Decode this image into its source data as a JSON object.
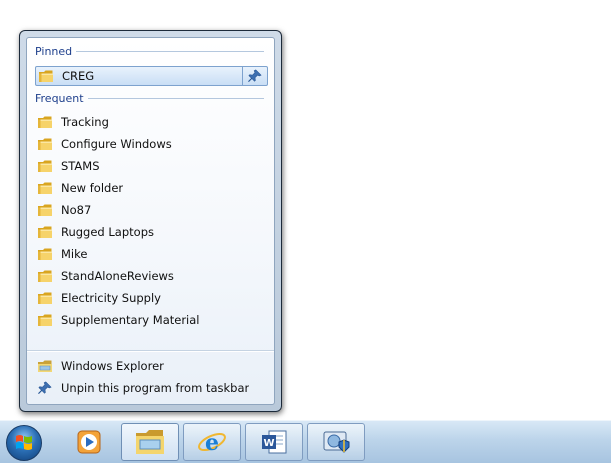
{
  "jumplist": {
    "pinned_header": "Pinned",
    "pinned_items": [
      {
        "label": "CREG"
      }
    ],
    "frequent_header": "Frequent",
    "frequent_items": [
      {
        "label": "Tracking"
      },
      {
        "label": "Configure Windows"
      },
      {
        "label": "STAMS"
      },
      {
        "label": "New folder"
      },
      {
        "label": "No87"
      },
      {
        "label": "Rugged Laptops"
      },
      {
        "label": "Mike"
      },
      {
        "label": "StandAloneReviews"
      },
      {
        "label": "Electricity Supply"
      },
      {
        "label": "Supplementary Material"
      }
    ],
    "tasks": [
      {
        "label": "Windows Explorer",
        "icon": "explorer-icon"
      },
      {
        "label": "Unpin this program from taskbar",
        "icon": "pin-icon"
      }
    ]
  },
  "taskbar": {
    "buttons": [
      {
        "name": "start-orb",
        "icon": "windows-logo-icon"
      },
      {
        "name": "media-player",
        "icon": "media-player-icon"
      },
      {
        "name": "windows-explorer",
        "icon": "explorer-icon",
        "state": "active"
      },
      {
        "name": "internet-explorer",
        "icon": "ie-icon",
        "state": "open"
      },
      {
        "name": "word",
        "icon": "word-icon",
        "state": "open"
      },
      {
        "name": "security-center",
        "icon": "shield-icon",
        "state": "open"
      }
    ]
  },
  "colors": {
    "category_header": "#1e3f8c",
    "folder_yellow": "#f2c94c",
    "taskbar_top": "#d8e8f6",
    "taskbar_bottom": "#a7c4e0"
  }
}
